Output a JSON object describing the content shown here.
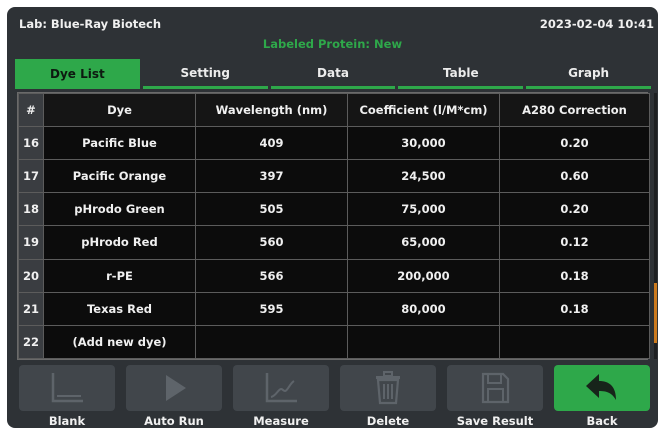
{
  "header": {
    "lab": "Lab: Blue-Ray Biotech",
    "datetime": "2023-02-04 10:41",
    "protein": "Labeled Protein: New"
  },
  "tabs": [
    "Dye List",
    "Setting",
    "Data",
    "Table",
    "Graph"
  ],
  "active_tab": "Dye List",
  "table": {
    "columns": [
      "#",
      "Dye",
      "Wavelength (nm)",
      "Coefficient (l/M*cm)",
      "A280 Correction"
    ],
    "rows": [
      [
        "16",
        "Pacific Blue",
        "409",
        "30,000",
        "0.20"
      ],
      [
        "17",
        "Pacific Orange",
        "397",
        "24,500",
        "0.60"
      ],
      [
        "18",
        "pHrodo Green",
        "505",
        "75,000",
        "0.20"
      ],
      [
        "19",
        "pHrodo Red",
        "560",
        "65,000",
        "0.12"
      ],
      [
        "20",
        "r-PE",
        "566",
        "200,000",
        "0.18"
      ],
      [
        "21",
        "Texas Red",
        "595",
        "80,000",
        "0.18"
      ],
      [
        "22",
        "(Add new dye)",
        "",
        "",
        ""
      ]
    ]
  },
  "toolbar": {
    "blank": "Blank",
    "auto_run": "Auto Run",
    "measure": "Measure",
    "delete": "Delete",
    "save_result": "Save Result",
    "back": "Back"
  },
  "colors": {
    "accent": "#2ea84a",
    "background": "#2e3236",
    "table_bg": "#0c0c0c",
    "scroll_thumb": "#cc7a1e"
  }
}
